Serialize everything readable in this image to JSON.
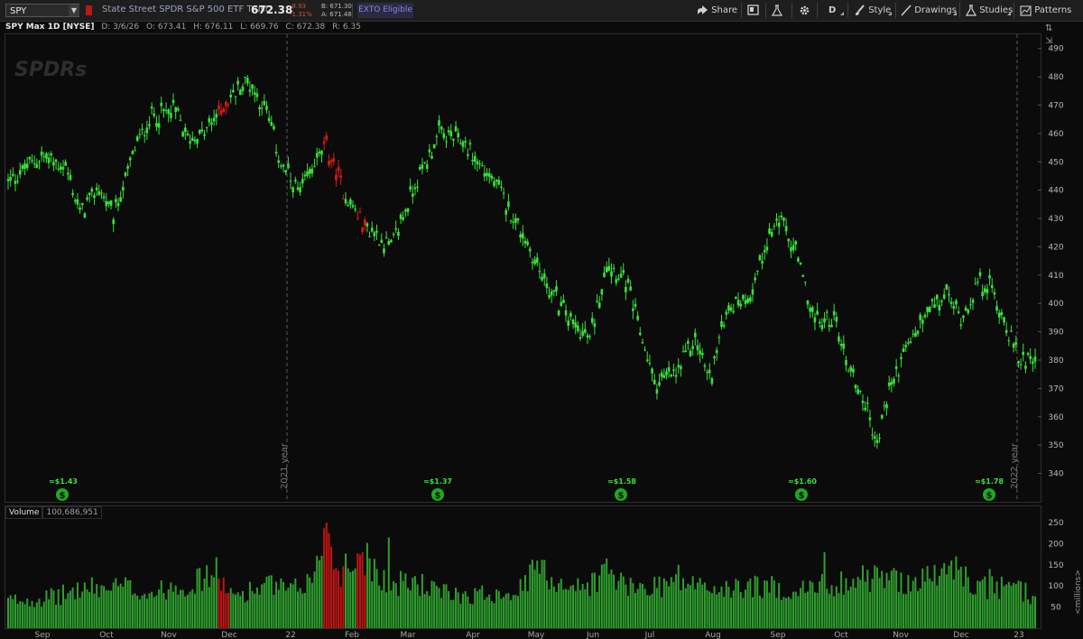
{
  "toolbar": {
    "symbol": "SPY",
    "description": "State Street SPDR S&P 500 ETF Trust",
    "last": "672.38",
    "change": "-8.93",
    "change_pct": "-1.31%",
    "bid": "B: 671.30",
    "ask": "A: 671.48",
    "badge": "EXTO Eligible",
    "share_label": "Share",
    "aggregation": "D",
    "style_label": "Style",
    "drawings_label": "Drawings",
    "studies_label": "Studies",
    "patterns_label": "Patterns",
    "colors": {
      "down": "#d54a4a",
      "badge": "#8e7fff"
    }
  },
  "chart_header": {
    "title": "SPY Max 1D [NYSE]",
    "date": "D: 3/6/26",
    "open": "O: 673.41",
    "high": "H: 676.11",
    "low": "L: 669.76",
    "close": "C: 672.38",
    "range": "R: 6.35"
  },
  "watermark": "SPDRs",
  "volume_header": {
    "label": "Volume",
    "value": "100,686,951"
  },
  "price_axis": {
    "ticks": [
      "490",
      "480",
      "470",
      "460",
      "450",
      "440",
      "430",
      "420",
      "410",
      "400",
      "390",
      "380",
      "370",
      "360",
      "350",
      "340"
    ]
  },
  "volume_axis": {
    "ticks": [
      "250",
      "200",
      "150",
      "100",
      "50"
    ],
    "unit": "<millions>"
  },
  "year_markers": [
    "2021 year",
    "2022 year"
  ],
  "dividends": [
    "≈$1.43",
    "≈$1.37",
    "≈$1.58",
    "≈$1.60",
    "≈$1.78"
  ],
  "time_axis": {
    "labels": [
      "Sep",
      "Oct",
      "Nov",
      "Dec",
      "22",
      "Feb",
      "Mar",
      "Apr",
      "May",
      "Jun",
      "Jul",
      "Aug",
      "Sep",
      "Oct",
      "Nov",
      "Dec",
      "23"
    ]
  },
  "chart_data": {
    "type": "candlestick",
    "price_range": [
      330,
      495
    ],
    "volume_range_millions": [
      0,
      265
    ],
    "colors": {
      "up": "#38e238",
      "down": "#e01818"
    },
    "close_path": [
      [
        0,
        443
      ],
      [
        14,
        452
      ],
      [
        24,
        448
      ],
      [
        30,
        432
      ],
      [
        38,
        441
      ],
      [
        44,
        430
      ],
      [
        53,
        455
      ],
      [
        60,
        466
      ],
      [
        70,
        468
      ],
      [
        75,
        458
      ],
      [
        82,
        460
      ],
      [
        92,
        472
      ],
      [
        100,
        479
      ],
      [
        108,
        468
      ],
      [
        114,
        449
      ],
      [
        122,
        438
      ],
      [
        128,
        450
      ],
      [
        133,
        455
      ],
      [
        140,
        440
      ],
      [
        148,
        428
      ],
      [
        160,
        420
      ],
      [
        170,
        442
      ],
      [
        180,
        460
      ],
      [
        190,
        457
      ],
      [
        198,
        448
      ],
      [
        205,
        440
      ],
      [
        214,
        426
      ],
      [
        224,
        408
      ],
      [
        234,
        395
      ],
      [
        243,
        387
      ],
      [
        250,
        415
      ],
      [
        258,
        408
      ],
      [
        264,
        390
      ],
      [
        270,
        372
      ],
      [
        279,
        375
      ],
      [
        287,
        388
      ],
      [
        293,
        373
      ],
      [
        300,
        398
      ],
      [
        310,
        403
      ],
      [
        316,
        420
      ],
      [
        322,
        430
      ],
      [
        329,
        418
      ],
      [
        337,
        393
      ],
      [
        345,
        395
      ],
      [
        351,
        378
      ],
      [
        358,
        365
      ],
      [
        363,
        350
      ],
      [
        368,
        370
      ],
      [
        376,
        385
      ],
      [
        385,
        398
      ],
      [
        392,
        403
      ],
      [
        398,
        395
      ],
      [
        405,
        407
      ],
      [
        410,
        406
      ],
      [
        416,
        395
      ],
      [
        422,
        380
      ],
      [
        428,
        382
      ]
    ],
    "down_bars": [
      [
        88,
        92
      ],
      [
        132,
        140
      ],
      [
        146,
        149
      ]
    ],
    "volume_path": [
      [
        0,
        70
      ],
      [
        20,
        80
      ],
      [
        30,
        100
      ],
      [
        50,
        105
      ],
      [
        58,
        90
      ],
      [
        64,
        95
      ],
      [
        70,
        115
      ],
      [
        75,
        110
      ],
      [
        88,
        145
      ],
      [
        92,
        80
      ],
      [
        100,
        95
      ],
      [
        110,
        110
      ],
      [
        118,
        92
      ],
      [
        128,
        130
      ],
      [
        132,
        250
      ],
      [
        138,
        145
      ],
      [
        148,
        190
      ],
      [
        160,
        110
      ],
      [
        170,
        120
      ],
      [
        180,
        90
      ],
      [
        195,
        85
      ],
      [
        215,
        100
      ],
      [
        220,
        155
      ],
      [
        228,
        125
      ],
      [
        240,
        100
      ],
      [
        250,
        145
      ],
      [
        260,
        100
      ],
      [
        280,
        120
      ],
      [
        300,
        95
      ],
      [
        310,
        110
      ],
      [
        330,
        95
      ],
      [
        345,
        115
      ],
      [
        360,
        130
      ],
      [
        380,
        120
      ],
      [
        395,
        150
      ],
      [
        405,
        105
      ],
      [
        420,
        100
      ],
      [
        428,
        85
      ]
    ],
    "volume_spikes": [
      [
        133,
        250
      ],
      [
        148,
        180
      ],
      [
        159,
        215
      ],
      [
        221,
        160
      ],
      [
        250,
        165
      ],
      [
        280,
        150
      ],
      [
        341,
        180
      ],
      [
        396,
        170
      ],
      [
        410,
        140
      ]
    ]
  }
}
